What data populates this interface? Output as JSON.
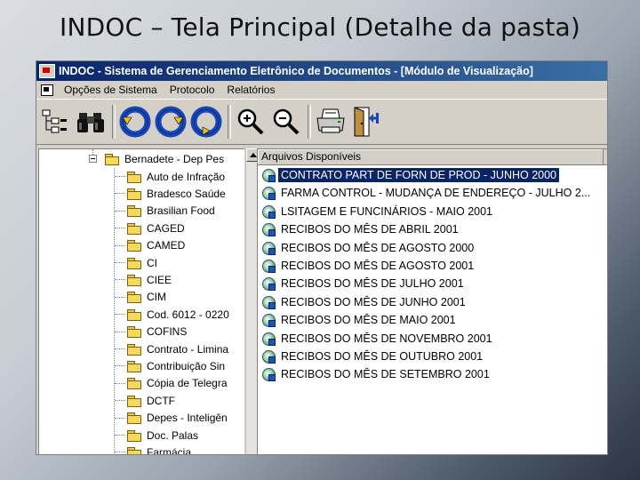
{
  "slide_title": "INDOC – Tela Principal (Detalhe da pasta)",
  "window": {
    "title": "INDOC - Sistema de Gerenciamento Eletrônico de Documentos - [Módulo de Visualização]"
  },
  "menu": [
    "Opções de Sistema",
    "Protocolo",
    "Relatórios"
  ],
  "toolbar": {
    "icons": [
      "tree-view-icon",
      "binoculars-icon",
      "rotate-left-icon",
      "rotate-right-icon",
      "rotate-down-icon",
      "zoom-in-icon",
      "zoom-out-icon",
      "printer-icon",
      "exit-door-icon"
    ]
  },
  "tree": {
    "root": "Bernadete - Dep Pes",
    "items": [
      "Auto de Infração",
      "Bradesco Saúde",
      "Brasilian Food",
      "CAGED",
      "CAMED",
      "CI",
      "CIEE",
      "CIM",
      "Cod. 6012 - 0220",
      "COFINS",
      "Contrato - Limina",
      "Contribuição Sin",
      "Cópia de Telegra",
      "DCTF",
      "Depes - Inteligên",
      "Doc. Palas",
      "Farmácia"
    ]
  },
  "list": {
    "header": "Arquivos Disponíveis",
    "selected_index": 0,
    "items": [
      "CONTRATO PART DE FORN DE PROD - JUNHO 2000",
      "FARMA CONTROL - MUDANÇA DE ENDEREÇO - JULHO 2...",
      "LSITAGEM E FUNCINÁRIOS - MAIO 2001",
      "RECIBOS DO MÊS DE ABRIL 2001",
      "RECIBOS DO MÊS DE AGOSTO 2000",
      "RECIBOS DO MÊS DE AGOSTO 2001",
      "RECIBOS DO MÊS DE JULHO 2001",
      "RECIBOS DO MÊS DE JUNHO 2001",
      "RECIBOS DO MÊS DE MAIO 2001",
      "RECIBOS DO MÊS DE NOVEMBRO 2001",
      "RECIBOS DO MÊS DE OUTUBRO 2001",
      "RECIBOS DO MÊS DE SETEMBRO 2001"
    ]
  },
  "colors": {
    "titlebar": "#0a246a",
    "selection": "#0a246a",
    "window_bg": "#d4d0c8"
  }
}
